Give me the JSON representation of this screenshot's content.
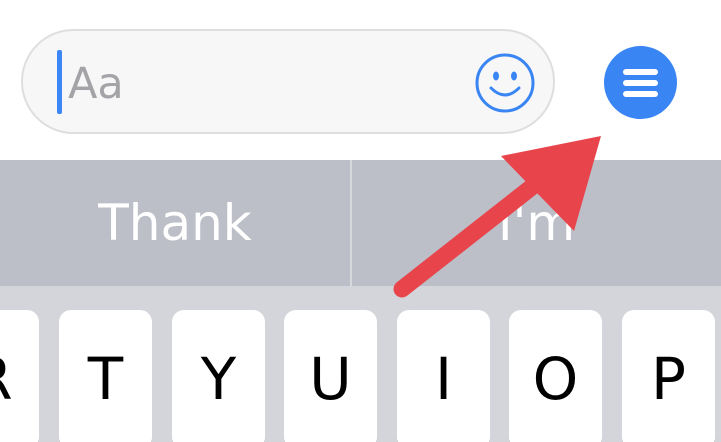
{
  "composer": {
    "placeholder": "Aa",
    "emoji_icon": "smiley-face-icon",
    "menu_icon": "hamburger-menu-icon"
  },
  "suggestions": [
    {
      "label": "Thank"
    },
    {
      "label": "I'm"
    }
  ],
  "keyboard": {
    "keys": [
      "R",
      "T",
      "Y",
      "U",
      "I",
      "O",
      "P"
    ]
  },
  "annotation": {
    "arrow_color": "#e8444b",
    "arrow_icon": "red-arrow-pointer"
  },
  "colors": {
    "accent": "#3a85f4",
    "suggestion_bar": "#bcbfc7",
    "keyboard_bg": "#d4d5da"
  }
}
